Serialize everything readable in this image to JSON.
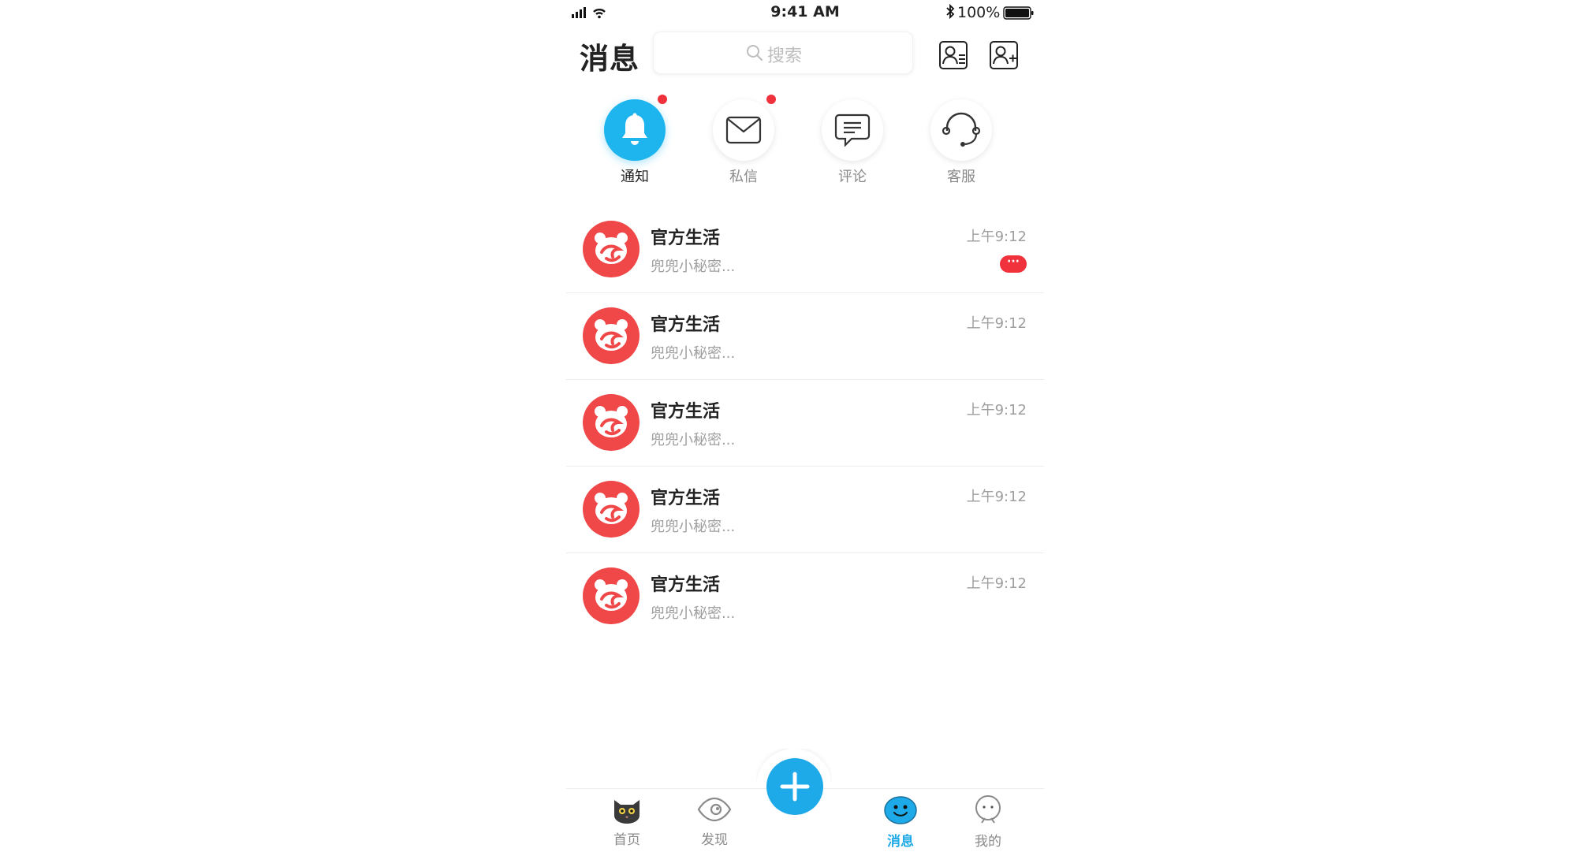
{
  "status_bar": {
    "time": "9:41 AM",
    "battery": "100%"
  },
  "header": {
    "title": "消息",
    "search_placeholder": "搜索"
  },
  "quick_actions": [
    {
      "label": "通知",
      "icon": "bell-icon",
      "active": true,
      "unread_dot": true
    },
    {
      "label": "私信",
      "icon": "mail-icon",
      "active": false,
      "unread_dot": true
    },
    {
      "label": "评论",
      "icon": "comment-icon",
      "active": false,
      "unread_dot": false
    },
    {
      "label": "客服",
      "icon": "headset-icon",
      "active": false,
      "unread_dot": false
    }
  ],
  "messages": [
    {
      "name": "官方生活",
      "preview": "兜兜小秘密...",
      "time": "上午9:12",
      "badge": "···"
    },
    {
      "name": "官方生活",
      "preview": "兜兜小秘密...",
      "time": "上午9:12"
    },
    {
      "name": "官方生活",
      "preview": "兜兜小秘密...",
      "time": "上午9:12"
    },
    {
      "name": "官方生活",
      "preview": "兜兜小秘密...",
      "time": "上午9:12"
    },
    {
      "name": "官方生活",
      "preview": "兜兜小秘密...",
      "time": "上午9:12"
    }
  ],
  "tabbar": {
    "home": "首页",
    "discover": "发现",
    "messages": "消息",
    "me": "我的"
  },
  "colors": {
    "accent": "#1eaae8",
    "badge": "#f0323c",
    "avatar": "#f04848"
  }
}
